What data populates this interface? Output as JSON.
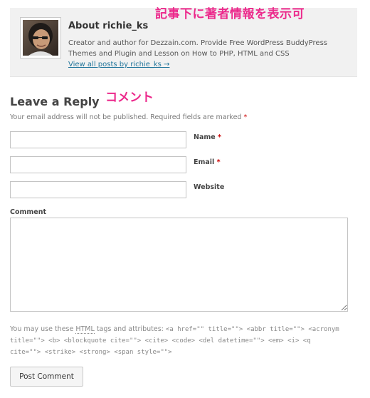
{
  "annotations": {
    "author_box_note": "記事下に著者情報を表示可",
    "comment_note": "コメント"
  },
  "author_box": {
    "avatar_icon": "person-photo-avatar",
    "title": "About richie_ks",
    "bio": "Creator and author for Dezzain.com. Provide Free WordPress BuddyPress Themes and Plugin and Lesson on How to PHP, HTML and CSS",
    "link_text": "View all posts by richie_ks →"
  },
  "reply": {
    "title": "Leave a Reply",
    "notes_text": "Your email address will not be published. Required fields are marked ",
    "required_marker": "*"
  },
  "fields": {
    "name": {
      "label": "Name",
      "required": "*",
      "value": ""
    },
    "email": {
      "label": "Email",
      "required": "*",
      "value": ""
    },
    "website": {
      "label": "Website",
      "value": ""
    },
    "comment": {
      "label": "Comment",
      "value": ""
    }
  },
  "allowed_tags": {
    "prefix": "You may use these ",
    "abbr": "HTML",
    "middle": " tags and attributes: ",
    "code": "<a href=\"\" title=\"\"> <abbr title=\"\"> <acronym title=\"\"> <b> <blockquote cite=\"\"> <cite> <code> <del datetime=\"\"> <em> <i> <q cite=\"\"> <strike> <strong> <span style=\"\">"
  },
  "submit": {
    "label": "Post Comment"
  },
  "colors": {
    "annotation": "#ec2a8c",
    "link": "#21759b",
    "required": "#cc0000",
    "author_box_bg": "#f1f1f1"
  }
}
